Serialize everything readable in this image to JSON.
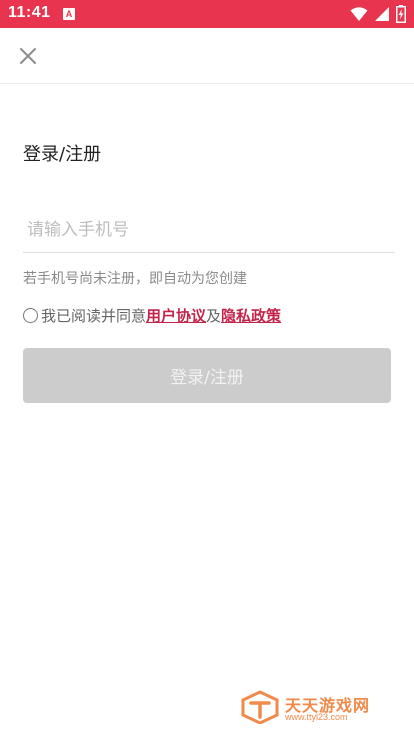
{
  "status_bar": {
    "time": "11:41",
    "notification_icon": "A",
    "icons": [
      "wifi-icon",
      "signal-icon",
      "battery-charging-icon"
    ],
    "color": "#e8344e"
  },
  "topbar": {
    "close_icon": "close-icon"
  },
  "login": {
    "title": "登录/注册",
    "phone_placeholder": "请输入手机号",
    "phone_value": "",
    "hint": "若手机号尚未注册，即自动为您创建",
    "agreement": {
      "checked": false,
      "prefix": "我已阅读并同意",
      "user_agreement": "用户协议",
      "conjunction": "及",
      "privacy_policy": "隐私政策",
      "link_color": "#c4244a"
    },
    "submit_label": "登录/注册",
    "submit_color": "#cccccc"
  },
  "watermark": {
    "title": "天天游戏网",
    "url": "www.ttyl23.com"
  }
}
